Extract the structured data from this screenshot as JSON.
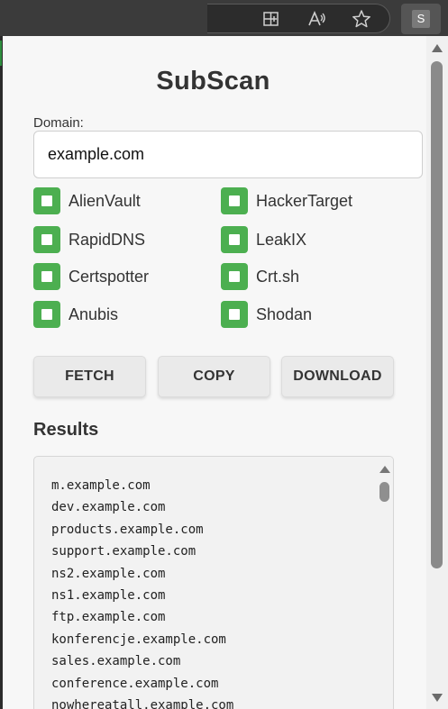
{
  "browser": {
    "extension_badge": "S",
    "icons": [
      "split-screen-icon",
      "read-aloud-icon",
      "favorite-star-icon"
    ]
  },
  "popup": {
    "title": "SubScan",
    "domain_label": "Domain:",
    "domain_value": "example.com",
    "sources": [
      {
        "label": "AlienVault",
        "checked": true
      },
      {
        "label": "HackerTarget",
        "checked": true
      },
      {
        "label": "RapidDNS",
        "checked": true
      },
      {
        "label": "LeakIX",
        "checked": true
      },
      {
        "label": "Certspotter",
        "checked": true
      },
      {
        "label": "Crt.sh",
        "checked": true
      },
      {
        "label": "Anubis",
        "checked": true
      },
      {
        "label": "Shodan",
        "checked": true
      }
    ],
    "buttons": {
      "fetch": "FETCH",
      "copy": "COPY",
      "download": "DOWNLOAD"
    },
    "results_heading": "Results",
    "results": [
      "m.example.com",
      "dev.example.com",
      "products.example.com",
      "support.example.com",
      "ns2.example.com",
      "ns1.example.com",
      "ftp.example.com",
      "konferencje.example.com",
      "sales.example.com",
      "conference.example.com",
      "nowhereatall.example.com"
    ]
  },
  "colors": {
    "checkbox": "#4caf50",
    "popup_bg": "#f7f7f7",
    "toolbar_bg": "#3b3b3b"
  }
}
